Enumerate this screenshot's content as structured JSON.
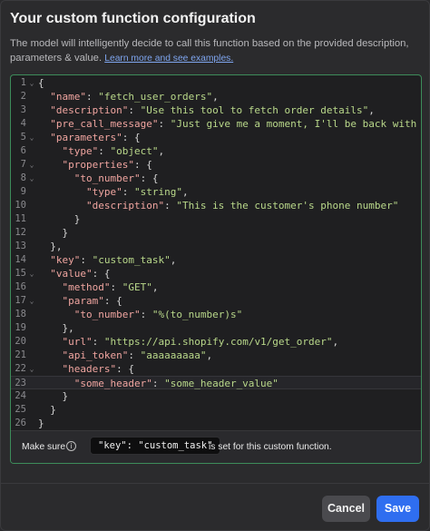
{
  "dialog": {
    "title": "Your custom function configuration",
    "description": "The model will intelligently decide to call this function based on the provided description, parameters & value.",
    "link_text": "Learn more and see examples."
  },
  "editor": {
    "lines": [
      {
        "n": "1",
        "fold": true,
        "tokens": [
          [
            "p",
            "{"
          ]
        ]
      },
      {
        "n": "2",
        "fold": false,
        "tokens": [
          [
            "p",
            "  "
          ],
          [
            "k",
            "\"name\""
          ],
          [
            "p",
            ": "
          ],
          [
            "s",
            "\"fetch_user_orders\""
          ],
          [
            "p",
            ","
          ]
        ]
      },
      {
        "n": "3",
        "fold": false,
        "tokens": [
          [
            "p",
            "  "
          ],
          [
            "k",
            "\"description\""
          ],
          [
            "p",
            ": "
          ],
          [
            "s",
            "\"Use this tool to fetch order details\""
          ],
          [
            "p",
            ","
          ]
        ]
      },
      {
        "n": "4",
        "fold": false,
        "tokens": [
          [
            "p",
            "  "
          ],
          [
            "k",
            "\"pre_call_message\""
          ],
          [
            "p",
            ": "
          ],
          [
            "s",
            "\"Just give me a moment, I'll be back with yo"
          ]
        ]
      },
      {
        "n": "5",
        "fold": true,
        "tokens": [
          [
            "p",
            "  "
          ],
          [
            "k",
            "\"parameters\""
          ],
          [
            "p",
            ": {"
          ]
        ]
      },
      {
        "n": "6",
        "fold": false,
        "tokens": [
          [
            "p",
            "    "
          ],
          [
            "k",
            "\"type\""
          ],
          [
            "p",
            ": "
          ],
          [
            "s",
            "\"object\""
          ],
          [
            "p",
            ","
          ]
        ]
      },
      {
        "n": "7",
        "fold": true,
        "tokens": [
          [
            "p",
            "    "
          ],
          [
            "k",
            "\"properties\""
          ],
          [
            "p",
            ": {"
          ]
        ]
      },
      {
        "n": "8",
        "fold": true,
        "tokens": [
          [
            "p",
            "      "
          ],
          [
            "k",
            "\"to_number\""
          ],
          [
            "p",
            ": {"
          ]
        ]
      },
      {
        "n": "9",
        "fold": false,
        "tokens": [
          [
            "p",
            "        "
          ],
          [
            "k",
            "\"type\""
          ],
          [
            "p",
            ": "
          ],
          [
            "s",
            "\"string\""
          ],
          [
            "p",
            ","
          ]
        ]
      },
      {
        "n": "10",
        "fold": false,
        "tokens": [
          [
            "p",
            "        "
          ],
          [
            "k",
            "\"description\""
          ],
          [
            "p",
            ": "
          ],
          [
            "s",
            "\"This is the customer's phone number\""
          ]
        ]
      },
      {
        "n": "11",
        "fold": false,
        "tokens": [
          [
            "p",
            "      }"
          ]
        ]
      },
      {
        "n": "12",
        "fold": false,
        "tokens": [
          [
            "p",
            "    }"
          ]
        ]
      },
      {
        "n": "13",
        "fold": false,
        "tokens": [
          [
            "p",
            "  },"
          ]
        ]
      },
      {
        "n": "14",
        "fold": false,
        "tokens": [
          [
            "p",
            "  "
          ],
          [
            "k",
            "\"key\""
          ],
          [
            "p",
            ": "
          ],
          [
            "s",
            "\"custom_task\""
          ],
          [
            "p",
            ","
          ]
        ]
      },
      {
        "n": "15",
        "fold": true,
        "tokens": [
          [
            "p",
            "  "
          ],
          [
            "k",
            "\"value\""
          ],
          [
            "p",
            ": {"
          ]
        ]
      },
      {
        "n": "16",
        "fold": false,
        "tokens": [
          [
            "p",
            "    "
          ],
          [
            "k",
            "\"method\""
          ],
          [
            "p",
            ": "
          ],
          [
            "s",
            "\"GET\""
          ],
          [
            "p",
            ","
          ]
        ]
      },
      {
        "n": "17",
        "fold": true,
        "tokens": [
          [
            "p",
            "    "
          ],
          [
            "k",
            "\"param\""
          ],
          [
            "p",
            ": {"
          ]
        ]
      },
      {
        "n": "18",
        "fold": false,
        "tokens": [
          [
            "p",
            "      "
          ],
          [
            "k",
            "\"to_number\""
          ],
          [
            "p",
            ": "
          ],
          [
            "s",
            "\"%(to_number)s\""
          ]
        ]
      },
      {
        "n": "19",
        "fold": false,
        "tokens": [
          [
            "p",
            "    },"
          ]
        ]
      },
      {
        "n": "20",
        "fold": false,
        "tokens": [
          [
            "p",
            "    "
          ],
          [
            "k",
            "\"url\""
          ],
          [
            "p",
            ": "
          ],
          [
            "s",
            "\"https://api.shopify.com/v1/get_order\""
          ],
          [
            "p",
            ","
          ]
        ]
      },
      {
        "n": "21",
        "fold": false,
        "tokens": [
          [
            "p",
            "    "
          ],
          [
            "k",
            "\"api_token\""
          ],
          [
            "p",
            ": "
          ],
          [
            "s",
            "\"aaaaaaaaa\""
          ],
          [
            "p",
            ","
          ]
        ]
      },
      {
        "n": "22",
        "fold": true,
        "tokens": [
          [
            "p",
            "    "
          ],
          [
            "k",
            "\"headers\""
          ],
          [
            "p",
            ": {"
          ]
        ]
      },
      {
        "n": "23",
        "fold": false,
        "active": true,
        "tokens": [
          [
            "p",
            "      "
          ],
          [
            "k",
            "\"some_header\""
          ],
          [
            "p",
            ": "
          ],
          [
            "s",
            "\"some_header_value\""
          ]
        ]
      },
      {
        "n": "24",
        "fold": false,
        "tokens": [
          [
            "p",
            "    }"
          ]
        ]
      },
      {
        "n": "25",
        "fold": false,
        "tokens": [
          [
            "p",
            "  }"
          ]
        ]
      },
      {
        "n": "26",
        "fold": false,
        "tokens": [
          [
            "p",
            "}"
          ]
        ]
      }
    ],
    "fold_icon": "chevron-down-icon"
  },
  "note": {
    "prefix": "Make sure",
    "icon": "info-icon",
    "code": "\"key\": \"custom_task\"",
    "suffix": "is set for this custom function."
  },
  "footer": {
    "cancel_label": "Cancel",
    "save_label": "Save"
  },
  "colors": {
    "accent": "#2f6ef0",
    "editor_border": "#3d8c5a",
    "json_key": "#f0a5a0",
    "json_string": "#b9d88a"
  }
}
